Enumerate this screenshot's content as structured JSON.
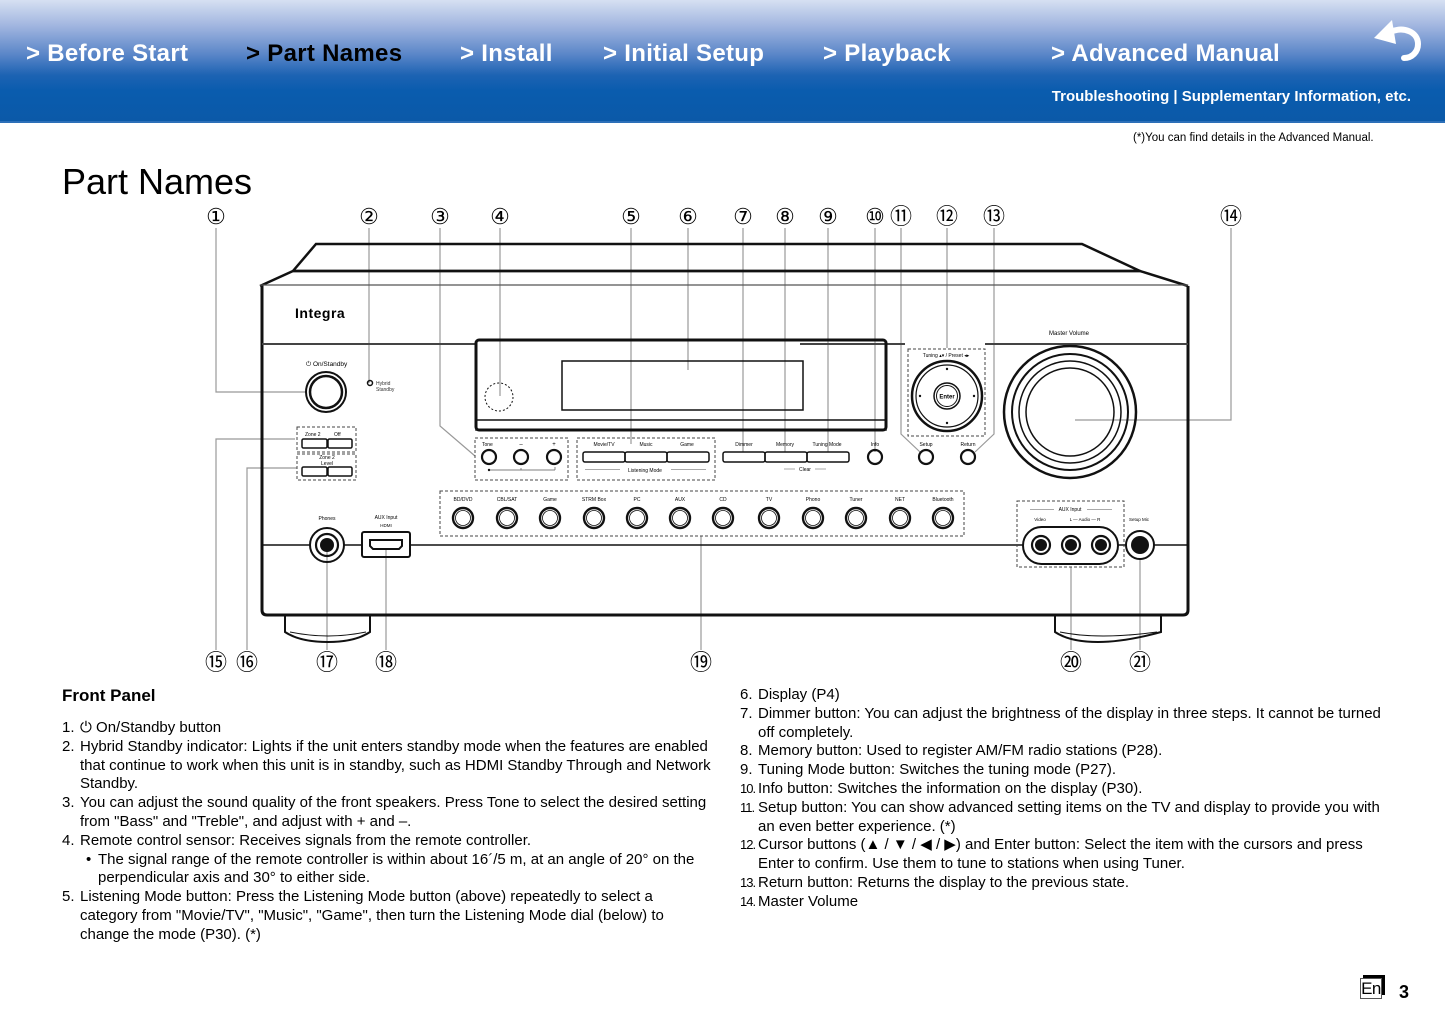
{
  "header": {
    "nav": [
      {
        "label": "> Before Start",
        "active": false
      },
      {
        "label": "> Part Names",
        "active": true
      },
      {
        "label": "> Install",
        "active": false
      },
      {
        "label": "> Initial Setup",
        "active": false
      },
      {
        "label": "> Playback",
        "active": false
      },
      {
        "label": "> Advanced Manual",
        "active": false
      }
    ],
    "subnav": "Troubleshooting | Supplementary Information, etc.",
    "back_icon": "return-arrow-icon",
    "bg_color": "#0b59a8"
  },
  "note": "(*)You can find details in the Advanced Manual.",
  "page_title": "Part Names",
  "diagram": {
    "callouts_top": [
      "①",
      "②",
      "③",
      "④",
      "⑤",
      "⑥",
      "⑦",
      "⑧",
      "⑨",
      "⑩",
      "⑪",
      "⑫",
      "⑬",
      "⑭"
    ],
    "callouts_bottom": [
      "⑮",
      "⑯",
      "⑰",
      "⑱",
      "⑲",
      "⑳",
      "㉑"
    ],
    "brand": "Integra",
    "labels": {
      "on_standby": "On/Standby",
      "hybrid_standby_1": "Hybrid",
      "hybrid_standby_2": "Standby",
      "zone2": "Zone 2",
      "off": "Off",
      "zone2_level_1": "Zone 2",
      "zone2_level_2": "Level",
      "tone": "Tone",
      "minus": "–",
      "plus": "+",
      "movie_tv": "Movie/TV",
      "music": "Music",
      "game": "Game",
      "listening_mode": "Listening Mode",
      "dimmer": "Dimmer",
      "memory": "Memory",
      "tuning_mode": "Tuning Mode",
      "clear": "Clear",
      "info": "Info",
      "tuning_preset": "Tuning ▴▾ / Preset ◂▸",
      "enter": "Enter",
      "setup": "Setup",
      "return": "Return",
      "master_volume": "Master Volume",
      "phones": "Phones",
      "aux_input": "AUX Input",
      "hdmi": "HDMI",
      "aux_input_right": "AUX Input",
      "video": "Video",
      "audio_lr": "L — Audio — R",
      "setup_mic": "Setup Mic"
    },
    "input_selectors": [
      "BD/DVD",
      "CBL/SAT",
      "Game",
      "STRM Box",
      "PC",
      "AUX",
      "CD",
      "TV",
      "Phono",
      "Tuner",
      "NET",
      "Bluetooth"
    ]
  },
  "front_panel": {
    "title": "Front Panel",
    "left_items": [
      {
        "num": "1.",
        "text": "⏻ On/Standby button"
      },
      {
        "num": "2.",
        "text": "Hybrid Standby indicator: Lights if the unit enters standby mode when the features are enabled that continue to work when this unit is in standby, such as HDMI Standby Through and Network Standby."
      },
      {
        "num": "3.",
        "text": "You can adjust the sound quality of the front speakers. Press Tone to select the desired setting from \"Bass\" and \"Treble\", and adjust with + and –."
      },
      {
        "num": "4.",
        "text": "Remote control sensor: Receives signals from the remote controller."
      },
      {
        "bullet": "The signal range of the remote controller is within about 16´/5 m, at an angle of 20° on the perpendicular axis and 30° to either side."
      },
      {
        "num": "5.",
        "text": "Listening Mode button: Press the Listening Mode button (above) repeatedly to select a category from \"Movie/TV\", \"Music\", \"Game\", then turn the Listening Mode dial (below) to change the mode (P30). (*)"
      }
    ],
    "right_items": [
      {
        "num": "6.",
        "text": "Display (P4)"
      },
      {
        "num": "7.",
        "text": "Dimmer button: You can adjust the brightness of the display in three steps. It cannot be turned off completely."
      },
      {
        "num": "8.",
        "text": "Memory button: Used to register AM/FM radio stations (P28)."
      },
      {
        "num": "9.",
        "text": "Tuning Mode button: Switches the tuning mode (P27)."
      },
      {
        "num": "10.",
        "text": "Info button: Switches the information on the display (P30)."
      },
      {
        "num": "11.",
        "text": "Setup button: You can show advanced setting items on the TV and display to provide you with an even better experience. (*)"
      },
      {
        "num": "12.",
        "text": "Cursor buttons (▲ / ▼ / ◀ / ▶) and Enter button: Select the item with the cursors and press Enter to confirm. Use them to tune to stations when using Tuner."
      },
      {
        "num": "13.",
        "text": "Return button: Returns the display to the previous state."
      },
      {
        "num": "14.",
        "text": "Master Volume"
      }
    ]
  },
  "footer": {
    "language": "En",
    "page_number": "3"
  }
}
